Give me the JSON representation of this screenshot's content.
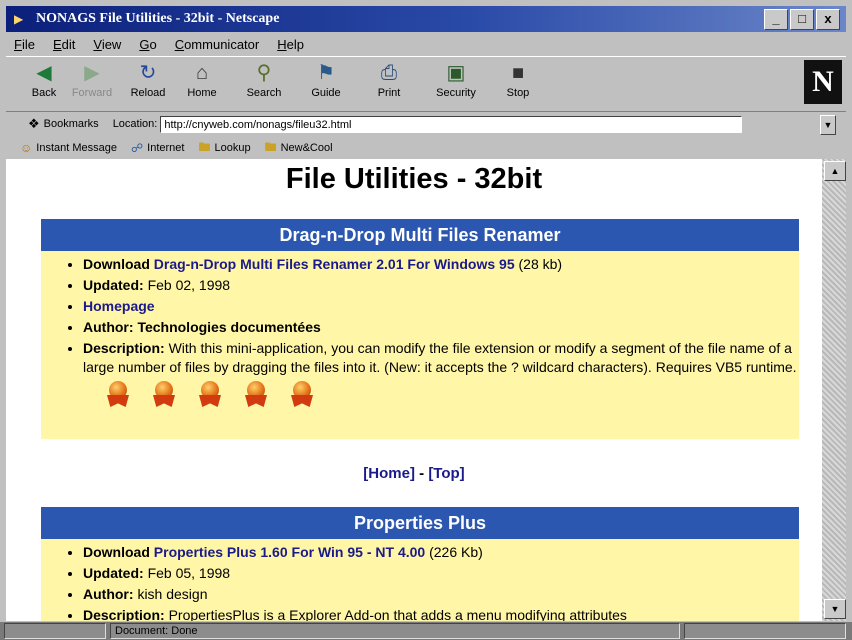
{
  "window": {
    "title": "NONAGS File Utilities - 32bit - Netscape",
    "controls": [
      "_",
      "□",
      "x"
    ]
  },
  "menu": [
    "File",
    "Edit",
    "View",
    "Go",
    "Communicator",
    "Help"
  ],
  "toolbar": [
    {
      "label": "Back",
      "icon": "back-arrow-icon"
    },
    {
      "label": "Forward",
      "icon": "forward-arrow-icon"
    },
    {
      "label": "Reload",
      "icon": "reload-icon"
    },
    {
      "label": "Home",
      "icon": "home-icon"
    },
    {
      "label": "Search",
      "icon": "search-icon"
    },
    {
      "label": "Guide",
      "icon": "guide-icon"
    },
    {
      "label": "Print",
      "icon": "print-icon"
    },
    {
      "label": "Security",
      "icon": "lock-icon"
    },
    {
      "label": "Stop",
      "icon": "stop-icon"
    }
  ],
  "location": {
    "bookmarks_label": "Bookmarks",
    "location_label": "Location:",
    "url": "http://cnyweb.com/nonags/fileu32.html"
  },
  "personal_bar": [
    "Instant Message",
    "Internet",
    "Lookup",
    "New&Cool"
  ],
  "page": {
    "title": "File Utilities - 32bit",
    "sections": [
      {
        "heading": "Drag-n-Drop Multi Files Renamer",
        "download_label": "Download",
        "download_link": "Drag-n-Drop Multi Files Renamer 2.01 For Windows 95",
        "download_size": "(28 kb)",
        "updated_label": "Updated:",
        "updated": "Feb 02, 1998",
        "homepage": "Homepage",
        "author_label": "Author:",
        "author": "Technologies documentées",
        "description_label": "Description:",
        "description": "With this mini-application, you can modify the file extension or modify a segment of the file name of a large number of files by dragging the files into it. (New: it accepts the ? wildcard characters). Requires VB5 runtime.",
        "rating": 5
      },
      {
        "heading": "Properties Plus",
        "download_label": "Download",
        "download_link": "Properties Plus 1.60 For Win 95 - NT 4.00",
        "download_size": "(226 Kb)",
        "updated_label": "Updated:",
        "updated": "Feb 05, 1998",
        "author_label": "Author:",
        "author": "kish design",
        "description_label": "Description:",
        "description": "PropertiesPlus is a Explorer Add-on that adds a menu modifying attributes"
      }
    ],
    "nav": {
      "home": "[Home]",
      "sep": " - ",
      "top": "[Top]"
    }
  },
  "status": {
    "text": "Document: Done"
  },
  "colors": {
    "section_header": "#2b57b0",
    "section_bg": "#fff6a8",
    "link": "#1a1a8a",
    "titlebar": "#0b1f7a"
  }
}
